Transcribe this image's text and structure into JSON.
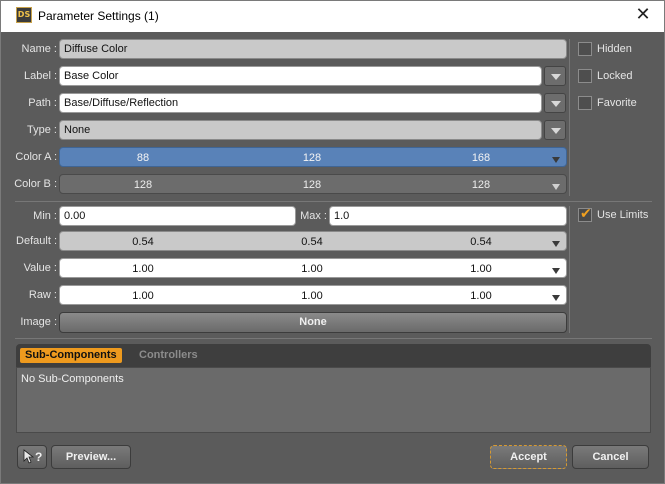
{
  "window": {
    "title": "Parameter Settings (1)",
    "app_icon_text": "DS"
  },
  "fields": {
    "name": {
      "label": "Name :",
      "value": "Diffuse Color"
    },
    "label": {
      "label": "Label :",
      "value": "Base Color"
    },
    "path": {
      "label": "Path :",
      "value": "Base/Diffuse/Reflection"
    },
    "type": {
      "label": "Type :",
      "value": "None"
    },
    "color_a": {
      "label": "Color A :",
      "values": [
        "88",
        "128",
        "168"
      ],
      "color": "#5982b8"
    },
    "color_b": {
      "label": "Color B :",
      "values": [
        "128",
        "128",
        "128"
      ]
    }
  },
  "flags": {
    "hidden": {
      "label": "Hidden",
      "checked": false
    },
    "locked": {
      "label": "Locked",
      "checked": false
    },
    "favorite": {
      "label": "Favorite",
      "checked": false
    },
    "use_limits": {
      "label": "Use Limits",
      "checked": true
    }
  },
  "limits": {
    "min": {
      "label": "Min :",
      "value": "0.00"
    },
    "max": {
      "label": "Max :",
      "value": "1.0"
    },
    "default": {
      "label": "Default :",
      "values": [
        "0.54",
        "0.54",
        "0.54"
      ]
    },
    "value": {
      "label": "Value :",
      "values": [
        "1.00",
        "1.00",
        "1.00"
      ]
    },
    "raw": {
      "label": "Raw :",
      "values": [
        "1.00",
        "1.00",
        "1.00"
      ]
    },
    "image": {
      "label": "Image :",
      "button": "None"
    }
  },
  "tabs": {
    "items": [
      {
        "label": "Sub-Components",
        "active": true
      },
      {
        "label": "Controllers",
        "active": false
      }
    ],
    "content": "No Sub-Components"
  },
  "footer": {
    "help_icon": "help-cursor-icon",
    "help_text": "?",
    "preview": "Preview...",
    "accept": "Accept",
    "cancel": "Cancel"
  },
  "colors": {
    "accent": "#ee9a1e",
    "background": "#5b5b5b"
  }
}
